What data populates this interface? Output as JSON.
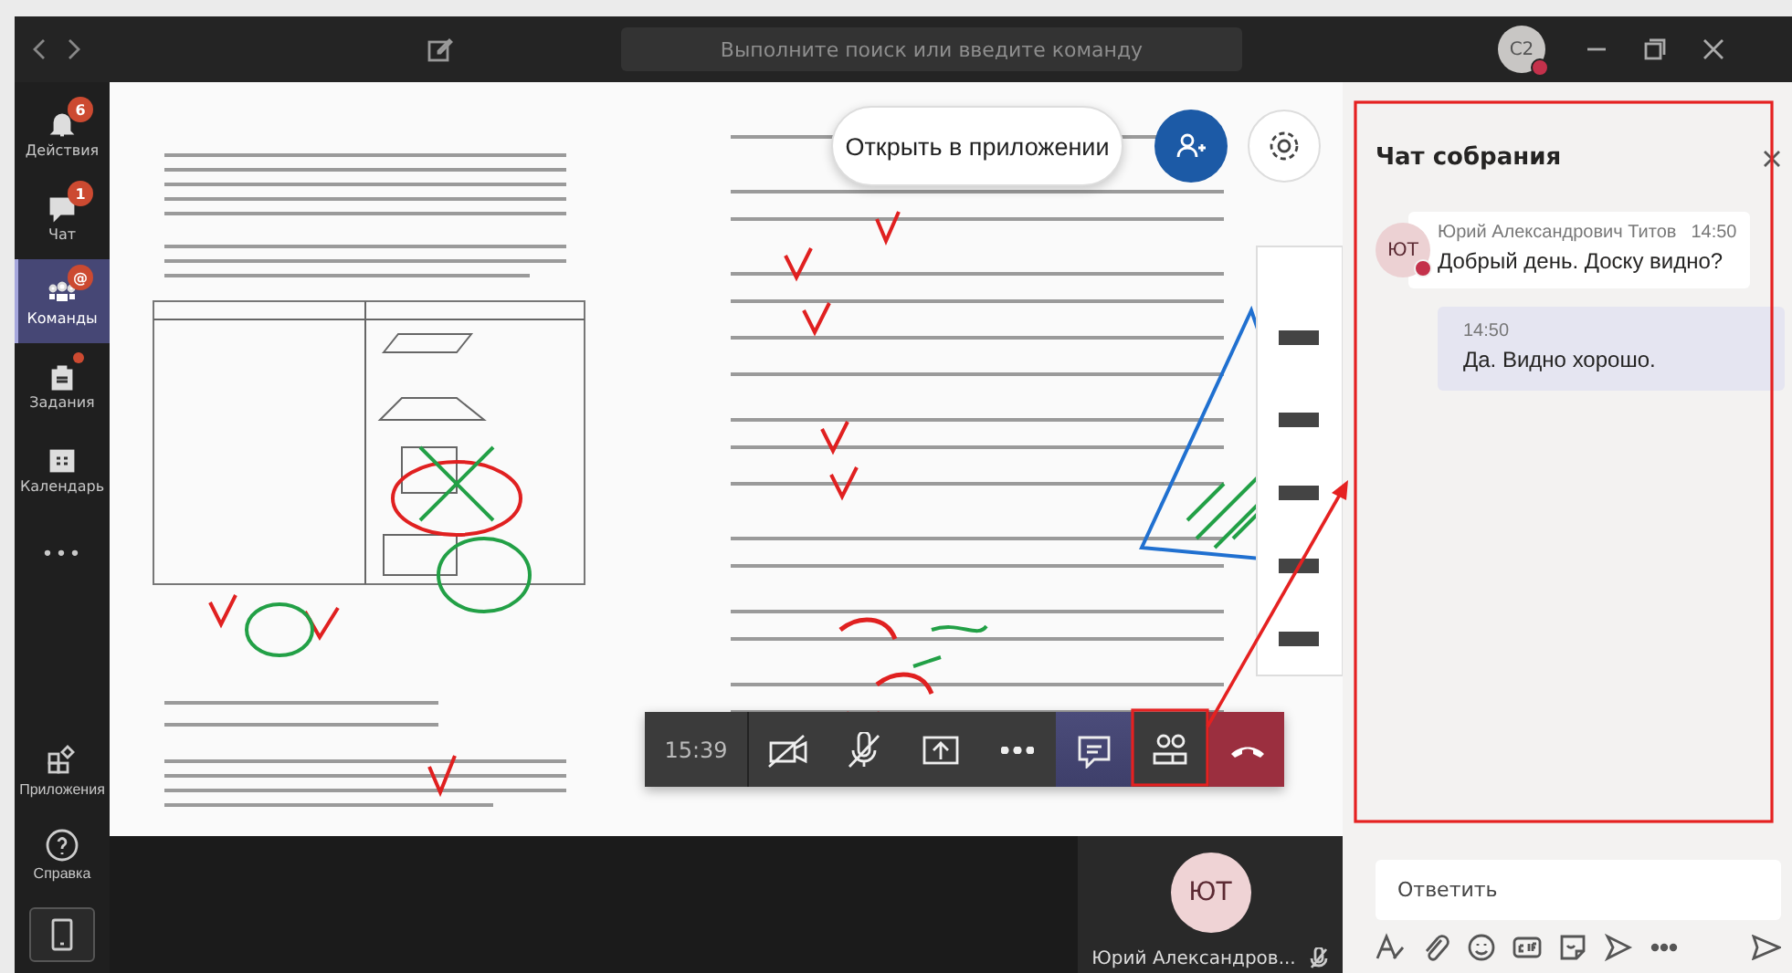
{
  "title_bar": {
    "search_placeholder": "Выполните поиск или введите команду",
    "user_initials": "C2"
  },
  "app_bar": {
    "items": [
      {
        "kind": "activity",
        "label": "Действия",
        "badge": "6",
        "unread_dot": false,
        "selected": false
      },
      {
        "kind": "chat",
        "label": "Чат",
        "badge": "1",
        "unread_dot": false,
        "selected": false
      },
      {
        "kind": "teams",
        "label": "Команды",
        "badge": "@",
        "unread_dot": false,
        "selected": true
      },
      {
        "kind": "assignments",
        "label": "Задания",
        "unread_dot": true,
        "selected": false
      },
      {
        "kind": "calendar",
        "label": "Календарь",
        "unread_dot": false,
        "selected": false
      },
      {
        "kind": "more",
        "label": "•••",
        "unread_dot": false,
        "selected": false
      }
    ],
    "bottom_items": [
      {
        "kind": "apps",
        "label": "Приложения"
      },
      {
        "kind": "help",
        "label": "Справка"
      },
      {
        "kind": "device"
      }
    ]
  },
  "stage": {
    "open_in_app_button": "Открыть в приложении"
  },
  "call_controls": {
    "duration": "15:39",
    "buttons": [
      {
        "kind": "camera",
        "selected": false
      },
      {
        "kind": "mic",
        "selected": false
      },
      {
        "kind": "share",
        "selected": false
      },
      {
        "kind": "more",
        "selected": false
      },
      {
        "kind": "chat",
        "selected": true
      },
      {
        "kind": "participants",
        "selected": false
      },
      {
        "kind": "hangup"
      }
    ]
  },
  "participant": {
    "initials": "ЮТ",
    "name": "Юрий Александров...",
    "muted": true
  },
  "chat": {
    "title": "Чат собрания",
    "messages": [
      {
        "kind": "incoming",
        "initials": "ЮТ",
        "author": "Юрий Александрович Титов",
        "time": "14:50",
        "text": "Добрый день. Доску видно?"
      },
      {
        "kind": "outgoing",
        "time": "14:50",
        "text": "Да. Видно хорошо."
      }
    ],
    "compose_placeholder": "Ответить",
    "toolbar": [
      {
        "kind": "format"
      },
      {
        "kind": "attach"
      },
      {
        "kind": "emoji"
      },
      {
        "kind": "gif"
      },
      {
        "kind": "sticker"
      },
      {
        "kind": "meet"
      },
      {
        "kind": "more"
      }
    ]
  }
}
